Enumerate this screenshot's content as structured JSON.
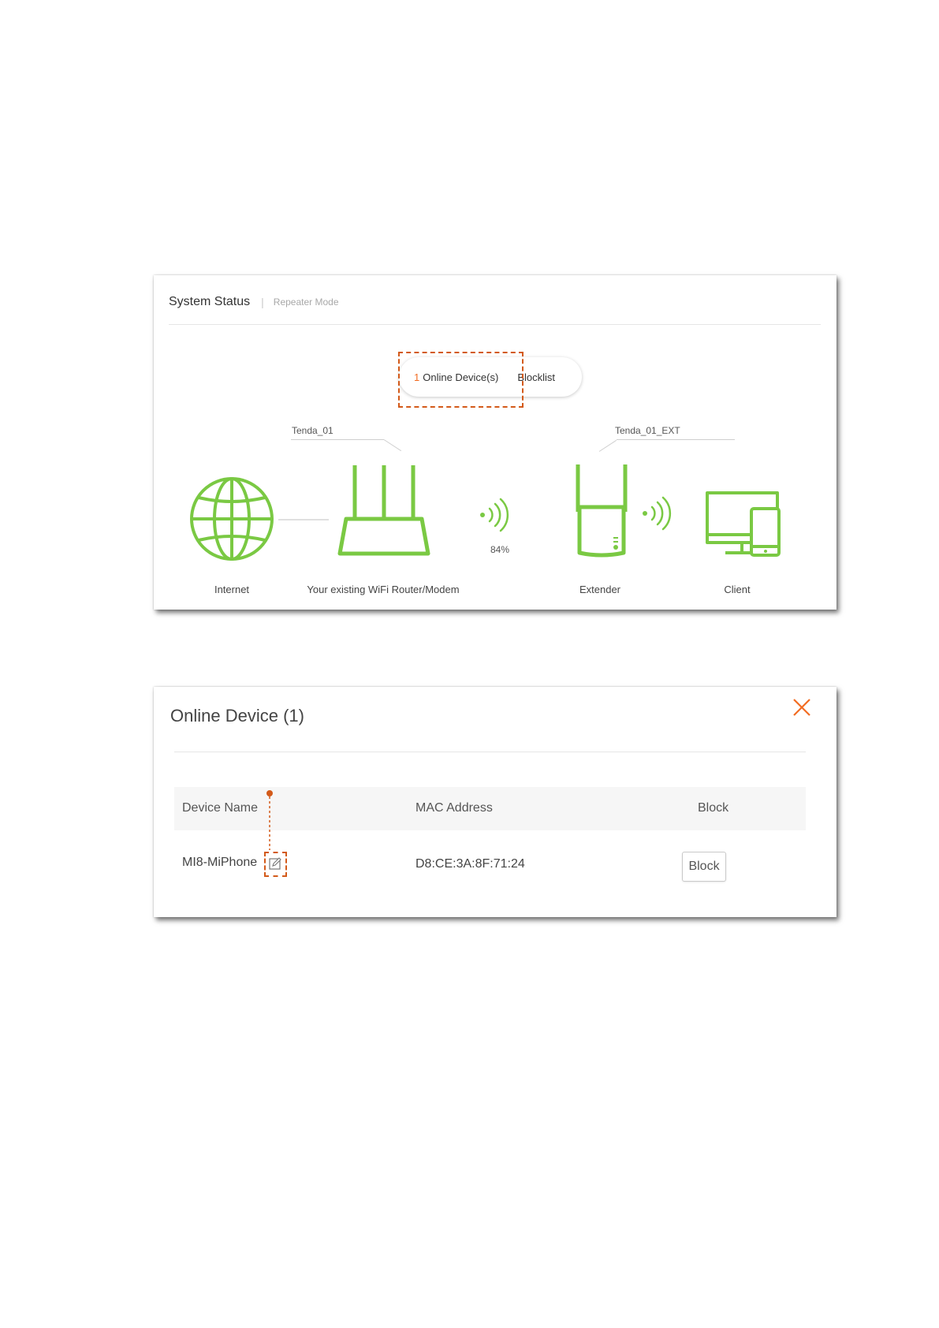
{
  "status_panel": {
    "title": "System Status",
    "separator": "|",
    "mode": "Repeater Mode",
    "tabs": {
      "online_count": "1",
      "online_label": "Online Device(s)",
      "blocklist_label": "Blocklist"
    },
    "router_ssid": "Tenda_01",
    "extender_ssid": "Tenda_01_EXT",
    "signal_strength": "84%",
    "captions": {
      "internet": "Internet",
      "router": "Your existing WiFi Router/Modem",
      "extender": "Extender",
      "client": "Client"
    },
    "colors": {
      "icon_green": "#7ac943",
      "accent_orange": "#f26c22",
      "annotation": "#d35a1a"
    },
    "icons": [
      "globe-icon",
      "router-icon",
      "wifi-signal-icon",
      "extender-icon",
      "client-devices-icon"
    ]
  },
  "device_panel": {
    "title": "Online Device (1)",
    "close_icon": "close-icon",
    "columns": [
      "Device Name",
      "MAC Address",
      "Block"
    ],
    "rows": [
      {
        "device_name": "MI8-MiPhone",
        "mac": "D8:CE:3A:8F:71:24",
        "action": "Block"
      }
    ],
    "edit_icon": "edit-icon"
  }
}
